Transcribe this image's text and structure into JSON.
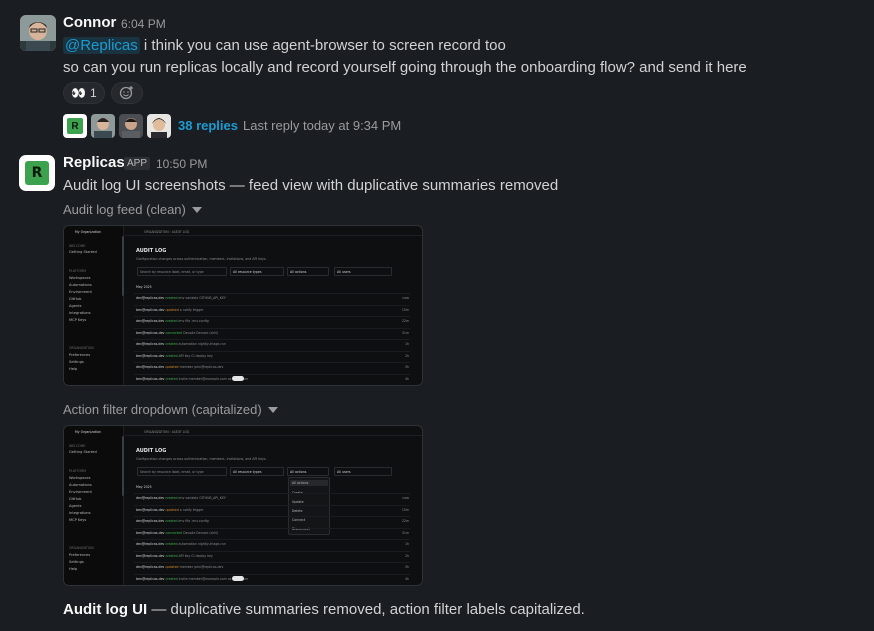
{
  "message1": {
    "author": "Connor",
    "time": "6:04 PM",
    "mention": "@Replicas",
    "line1_text": " i think you can use agent-browser to screen record too",
    "line2": "so can you run replicas locally and record yourself going through the onboarding flow? and send it here",
    "reaction_emoji": "👀",
    "reaction_count": "1",
    "add_reaction_icon": "☺+",
    "thread": {
      "replies": "38 replies",
      "last_reply": "Last reply today at 9:34 PM"
    }
  },
  "message2": {
    "author": "Replicas",
    "badge": "APP",
    "time": "10:50 PM",
    "logo_letter": "R",
    "text": "Audit log UI screenshots — feed view with duplicative summaries removed",
    "attachments": [
      {
        "title": "Audit log feed (clean)"
      },
      {
        "title": "Action filter dropdown (capitalized)"
      }
    ],
    "final_bold": "Audit log UI",
    "final_text": " — duplicative summaries removed, action filter labels capitalized."
  },
  "screenshot": {
    "org": "My Organization",
    "breadcrumb": "ORGANIZATION  ›  AUDIT LOG",
    "heading": "AUDIT LOG",
    "subheading": "Configuration changes across authentication, members, invitations, and API keys.",
    "search_placeholder": "Search by resource label, email, or type",
    "filter_resource": "All resource types",
    "filter_actions": "All actions",
    "filter_users": "All users",
    "month": "May 2025",
    "sidebar": {
      "welcome_header": "WELCOME",
      "getting_started": "Getting Started",
      "platform_header": "PLATFORM",
      "workspaces": "Workspaces",
      "automations": "Automations",
      "environment": "Environment",
      "github": "GitHub",
      "agents": "Agents",
      "integrations": "Integrations",
      "mcp": "MCP Keys",
      "org_header": "ORGANIZATION",
      "preferences": "Preferences",
      "settings": "Settings",
      "help": "Help"
    },
    "rows": [
      {
        "email": "dev@replicas.dev",
        "verb": "created",
        "obj": "env variable  GITHUB_API_KEY",
        "t": "now"
      },
      {
        "email": "ben@replicas.dev",
        "verb": "updated",
        "obj": "a notify trigger",
        "t": "15m"
      },
      {
        "email": "dev@replicas.dev",
        "verb": "created",
        "obj": "env file  .env.config",
        "t": "22m"
      },
      {
        "email": "ben@replicas.dev",
        "verb": "connected",
        "obj": "Decode  Decode (skill)",
        "t": "31m"
      },
      {
        "email": "dev@replicas.dev",
        "verb": "created",
        "obj": "automation  nightly-triage-run",
        "t": "1h"
      },
      {
        "email": "ben@replicas.dev",
        "verb": "created",
        "obj": "API key  CI deploy key",
        "t": "2h"
      },
      {
        "email": "dev@replicas.dev",
        "verb": "updated",
        "obj": "member  john@replicas.dev",
        "t": "3h"
      },
      {
        "email": "ben@replicas.dev",
        "verb": "created",
        "obj": "invite  member@example.com  as  developer",
        "t": "4h"
      }
    ],
    "dropdown_options": [
      "All actions",
      "Create",
      "Update",
      "Delete",
      "Connect",
      "Disconnect"
    ]
  },
  "colors": {
    "background": "#1a1d21",
    "link": "#1d9bd1",
    "brand_green": "#3da24d"
  }
}
